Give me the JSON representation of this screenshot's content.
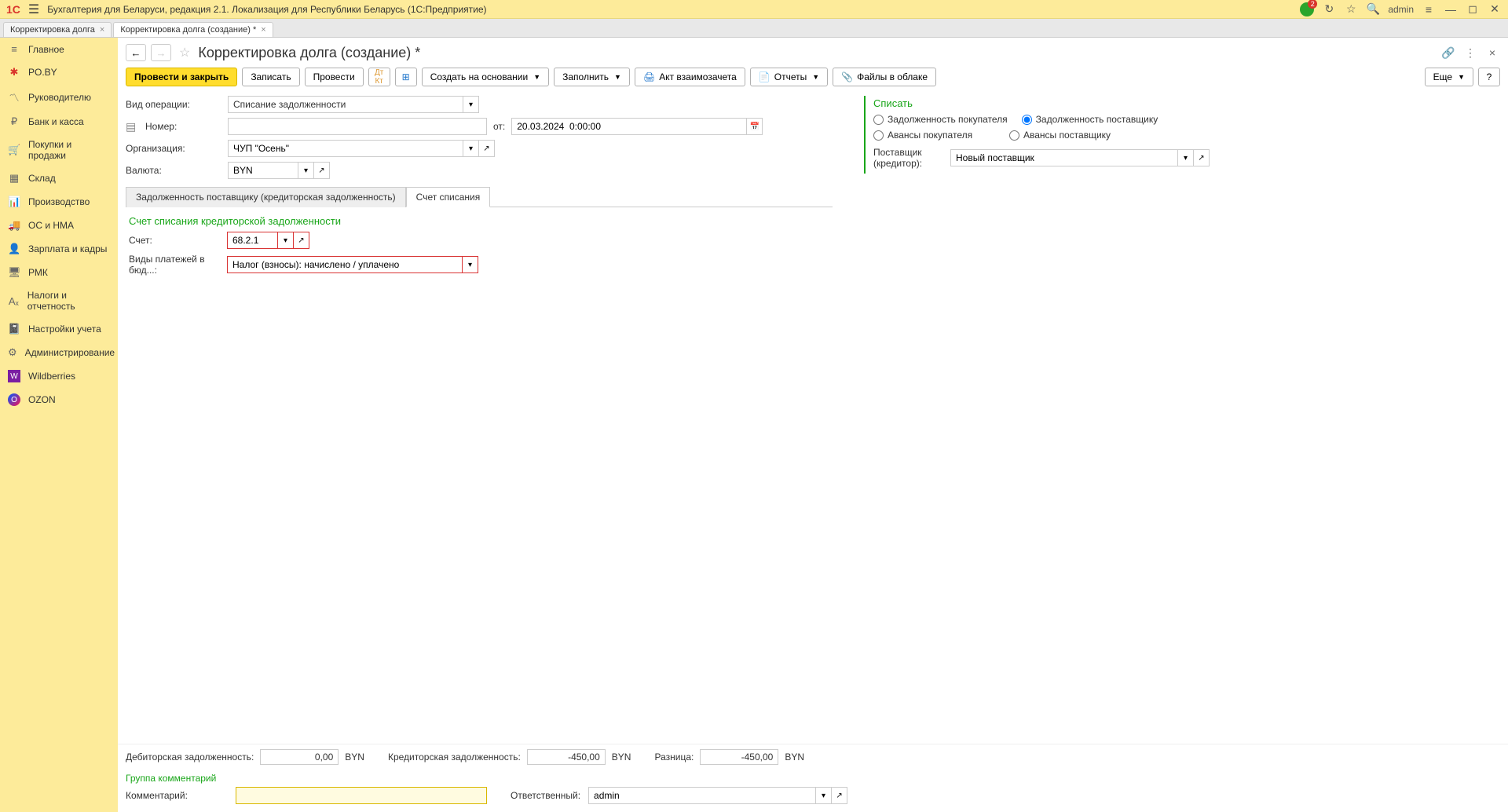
{
  "titlebar": {
    "app_title": "Бухгалтерия для Беларуси, редакция 2.1. Локализация для Республики Беларусь   (1С:Предприятие)",
    "username": "admin"
  },
  "tabs": [
    {
      "label": "Корректировка долга",
      "active": false
    },
    {
      "label": "Корректировка долга (создание) *",
      "active": true
    }
  ],
  "sidebar": [
    {
      "label": "Главное",
      "icon": "≡"
    },
    {
      "label": "PO.BY",
      "icon": "✱"
    },
    {
      "label": "Руководителю",
      "icon": "📈"
    },
    {
      "label": "Банк и касса",
      "icon": "₽"
    },
    {
      "label": "Покупки и продажи",
      "icon": "🛒"
    },
    {
      "label": "Склад",
      "icon": "▦"
    },
    {
      "label": "Производство",
      "icon": "🏭"
    },
    {
      "label": "ОС и НМА",
      "icon": "🚚"
    },
    {
      "label": "Зарплата и кадры",
      "icon": "👤"
    },
    {
      "label": "РМК",
      "icon": "🖥"
    },
    {
      "label": "Налоги и отчетность",
      "icon": "Aₓ"
    },
    {
      "label": "Настройки учета",
      "icon": "📓"
    },
    {
      "label": "Администрирование",
      "icon": "⚙"
    },
    {
      "label": "Wildberries",
      "icon": "W"
    },
    {
      "label": "OZON",
      "icon": "◯"
    }
  ],
  "doc": {
    "title": "Корректировка долга (создание) *"
  },
  "toolbar": {
    "post_close": "Провести и закрыть",
    "save": "Записать",
    "post": "Провести",
    "create_based": "Создать на основании",
    "fill": "Заполнить",
    "act": "Акт взаимозачета",
    "reports": "Отчеты",
    "files": "Файлы в облаке",
    "more": "Еще",
    "help": "?"
  },
  "form": {
    "operation_type_label": "Вид операции:",
    "operation_type_value": "Списание задолженности",
    "number_label": "Номер:",
    "number_value": "",
    "date_prefix": "от:",
    "date_value": "20.03.2024  0:00:00",
    "org_label": "Организация:",
    "org_value": "ЧУП \"Осень\"",
    "currency_label": "Валюта:",
    "currency_value": "BYN",
    "writeoff_section": "Списать",
    "radio_options": {
      "buyer_debt": "Задолженность покупателя",
      "supplier_debt": "Задолженность поставщику",
      "buyer_advances": "Авансы покупателя",
      "supplier_advances": "Авансы поставщику"
    },
    "supplier_label": "Поставщик (кредитор):",
    "supplier_value": "Новый поставщик"
  },
  "doc_tabs": {
    "tab1": "Задолженность поставщику (кредиторская задолженность)",
    "tab2": "Счет списания"
  },
  "writeoff_tab": {
    "section_title": "Счет списания кредиторской задолженности",
    "account_label": "Счет:",
    "account_value": "68.2.1",
    "payment_types_label": "Виды платежей в бюд...:",
    "payment_types_value": "Налог (взносы): начислено / уплачено"
  },
  "footer": {
    "debit_label": "Дебиторская задолженность:",
    "debit_value": "0,00",
    "debit_currency": "BYN",
    "credit_label": "Кредиторская задолженность:",
    "credit_value": "-450,00",
    "credit_currency": "BYN",
    "diff_label": "Разница:",
    "diff_value": "-450,00",
    "diff_currency": "BYN",
    "comment_group": "Группа комментарий",
    "comment_label": "Комментарий:",
    "comment_value": "",
    "responsible_label": "Ответственный:",
    "responsible_value": "admin"
  }
}
